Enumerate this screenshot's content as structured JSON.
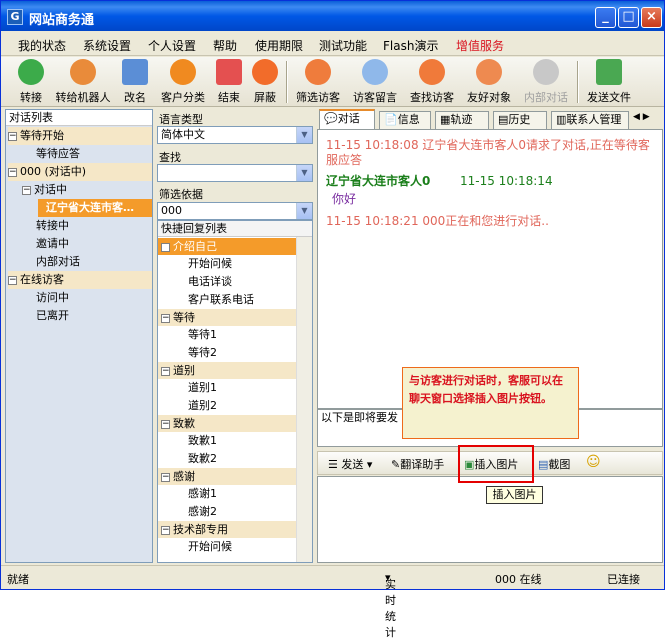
{
  "window": {
    "title": "网站商务通"
  },
  "menu": [
    "我的状态",
    "系统设置",
    "个人设置",
    "帮助",
    "使用期限",
    "测试功能",
    "Flash演示",
    "增值服务"
  ],
  "toolbar": [
    "转接",
    "转给机器人",
    "改名",
    "客户分类",
    "结束",
    "屏蔽",
    "筛选访客",
    "访客留言",
    "查找访客",
    "友好对象",
    "内部对话",
    "发送文件"
  ],
  "left": {
    "header": "对话列表",
    "items": [
      "等待开始",
      "等待应答",
      "000 (对话中)",
      "对话中",
      "辽宁省大连市客…",
      "转接中",
      "邀请中",
      "内部对话",
      "在线访客",
      "访问中",
      "已离开"
    ]
  },
  "middle": {
    "lang_label": "语言类型",
    "lang_value": "简体中文",
    "find_label": "查找",
    "find_value": "",
    "filter_label": "筛选依据",
    "filter_value": "000",
    "quick_header": "快捷回复列表",
    "groups": [
      {
        "name": "介绍自己",
        "items": [
          "开始问候",
          "电话详谈",
          "客户联系电话"
        ]
      },
      {
        "name": "等待",
        "items": [
          "等待1",
          "等待2"
        ]
      },
      {
        "name": "道别",
        "items": [
          "道别1",
          "道别2"
        ]
      },
      {
        "name": "致歉",
        "items": [
          "致歉1",
          "致歉2"
        ]
      },
      {
        "name": "感谢",
        "items": [
          "感谢1",
          "感谢2"
        ]
      },
      {
        "name": "技术部专用",
        "items": [
          "开始问候"
        ]
      }
    ]
  },
  "tabs": [
    "对话",
    "信息",
    "轨迹",
    "历史",
    "联系人管理"
  ],
  "chat": {
    "m1": "11-15 10:18:08  辽宁省大连市客人0请求了对话,正在等待客服应答",
    "m2_name": "辽宁省大连市客人0",
    "m2_time": "11-15 10:18:14",
    "m2_text": "你好",
    "m3": "11-15 10:18:21  000正在和您进行对话.."
  },
  "notice": "以下是即将要发",
  "chat_toolbar": {
    "send": "发送",
    "translate": "翻译助手",
    "insert_image": "插入图片",
    "screenshot": "截图"
  },
  "callout": "与访客进行对话时，客服可以在聊天窗口选择插入图片按钮。",
  "tooltip": "插入图片",
  "status": {
    "ready": "就绪",
    "stats": "实时统计",
    "online": "000 在线",
    "connected": "已连接"
  },
  "colors": {
    "accent": "#f49b2a",
    "system_msg": "#e0665a",
    "visitor_name": "#1b7f1b",
    "visitor_text": "#7a2ea0"
  }
}
